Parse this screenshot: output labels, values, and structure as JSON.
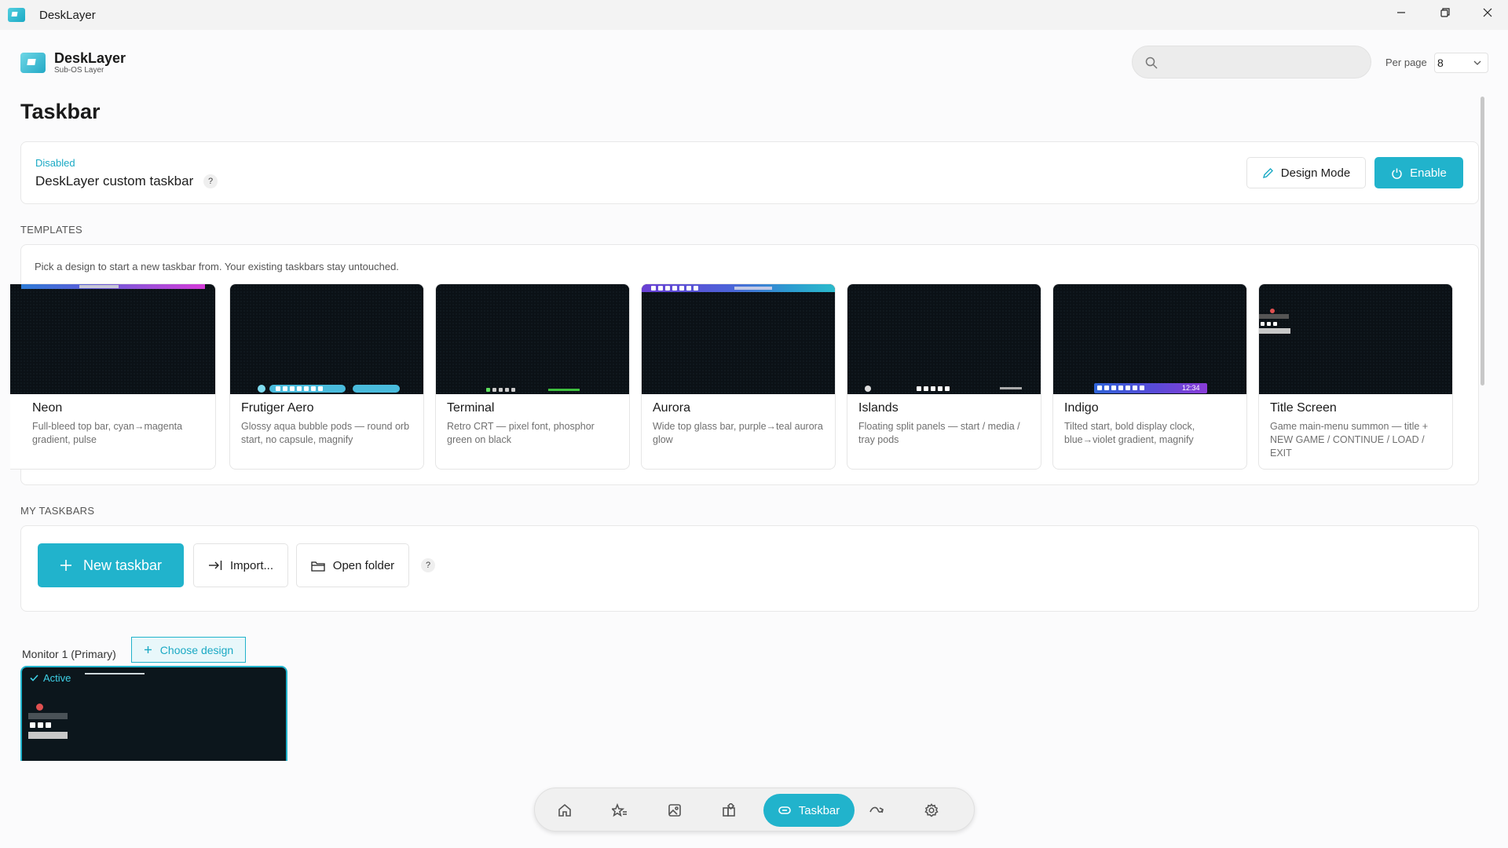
{
  "window": {
    "title": "DeskLayer"
  },
  "brand": {
    "name": "DeskLayer",
    "subtitle": "Sub-OS Layer"
  },
  "search": {
    "value": "",
    "placeholder": ""
  },
  "per_page": {
    "label": "Per page",
    "value": "8"
  },
  "page": {
    "title": "Taskbar"
  },
  "status": {
    "state": "Disabled",
    "label": "DeskLayer custom taskbar",
    "help": "?",
    "design_mode_label": "Design Mode",
    "enable_label": "Enable"
  },
  "templates": {
    "section_label": "TEMPLATES",
    "intro": "Pick a design to start a new taskbar from. Your existing taskbars stay untouched.",
    "items": [
      {
        "name": "Neon",
        "desc": "Full-bleed top bar, cyan→magenta gradient, pulse"
      },
      {
        "name": "Frutiger Aero",
        "desc": "Glossy aqua bubble pods — round orb start, no capsule, magnify"
      },
      {
        "name": "Terminal",
        "desc": "Retro CRT — pixel font, phosphor green on black"
      },
      {
        "name": "Aurora",
        "desc": "Wide top glass bar, purple→teal aurora glow"
      },
      {
        "name": "Islands",
        "desc": "Floating split panels — start / media / tray pods"
      },
      {
        "name": "Indigo",
        "desc": "Tilted start, bold display clock, blue→violet gradient, magnify"
      },
      {
        "name": "Title Screen",
        "desc": "Game main-menu summon — title + NEW GAME / CONTINUE / LOAD / EXIT"
      }
    ],
    "preview_clock": "12:34"
  },
  "my_taskbars": {
    "section_label": "MY TASKBARS",
    "new_label": "New taskbar",
    "import_label": "Import...",
    "open_folder_label": "Open folder",
    "help": "?"
  },
  "monitor": {
    "label": "Monitor 1 (Primary)",
    "choose_label": "Choose design",
    "active_label": "Active"
  },
  "nav": {
    "items": [
      "home-icon",
      "favorites-icon",
      "image-icon",
      "widgets-icon",
      "taskbar-icon",
      "gesture-icon",
      "settings-icon"
    ],
    "active_label": "Taskbar"
  },
  "colors": {
    "accent": "#21b3cc",
    "accent_text": "#1aa9c4"
  }
}
